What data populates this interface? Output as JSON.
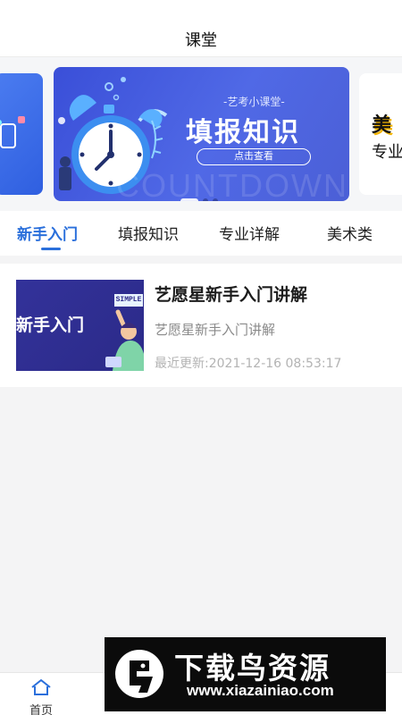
{
  "header": {
    "title": "课堂"
  },
  "banner": {
    "kicker": "-艺考小课堂-",
    "headline": "填报知识",
    "cta": "点击查看",
    "watermark": "COUNTDOWN",
    "next_slide": {
      "line1": "美",
      "line2": "专业"
    },
    "pages": 3,
    "active_page": 1
  },
  "tabs": [
    {
      "label": "新手入门",
      "active": true
    },
    {
      "label": "填报知识",
      "active": false
    },
    {
      "label": "专业详解",
      "active": false
    },
    {
      "label": "美术类",
      "active": false
    }
  ],
  "articles": [
    {
      "thumb_text": "新手入门",
      "thumb_sign": "SIMPLE",
      "title": "艺愿星新手入门讲解",
      "subtitle": "艺愿星新手入门讲解",
      "updated": "最近更新:2021-12-16 08:53:17"
    }
  ],
  "bottom_nav": [
    {
      "label": "首页",
      "icon": "home-icon"
    }
  ],
  "ad_overlay": {
    "name": "下载鸟资源",
    "url": "www.xiazainiao.com"
  },
  "colors": {
    "accent": "#2a6fdb",
    "banner_blue": "#3a4fd8"
  }
}
